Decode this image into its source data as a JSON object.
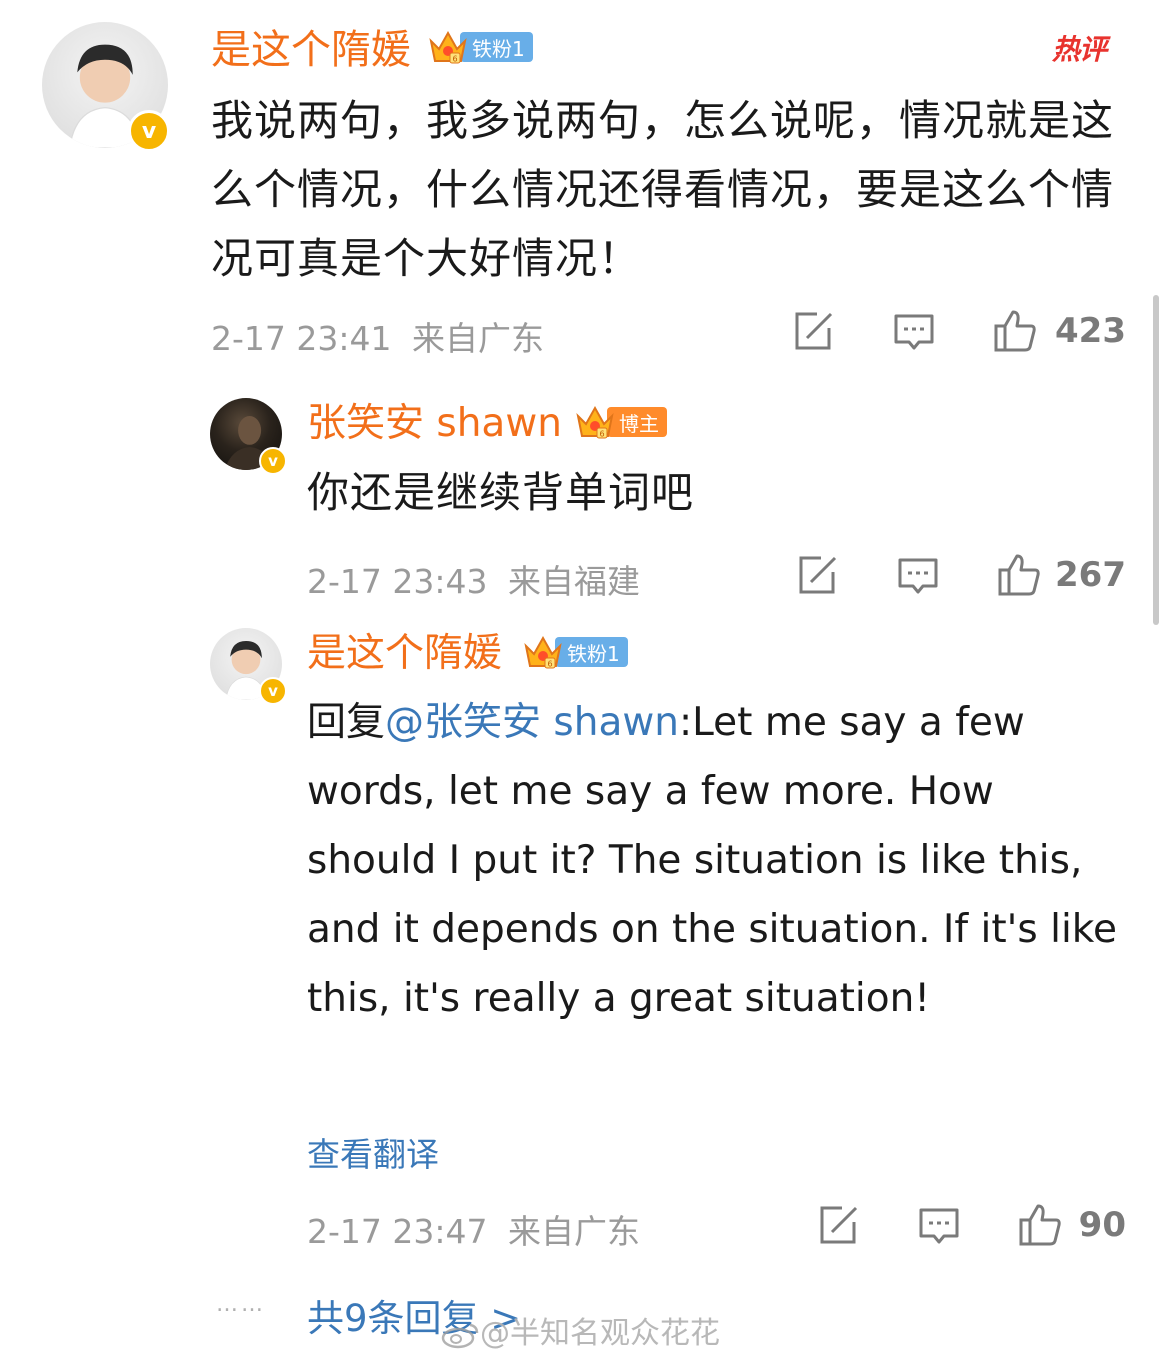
{
  "hot_label": "热评",
  "comment": {
    "username": "是这个隋媛",
    "badge_label": "铁粉1",
    "text": "我说两句，我多说两句，怎么说呢，情况就是这么个情况，什么情况还得看情况，要是这么个情况可真是个大好情况！",
    "timestamp": "2-17 23:41",
    "location": "来自广东",
    "likes": "423"
  },
  "replies": [
    {
      "username": "张笑安 shawn",
      "badge_label": "博主",
      "text": "你还是继续背单词吧",
      "timestamp": "2-17 23:43",
      "location": "来自福建",
      "likes": "267"
    },
    {
      "username": "是这个隋媛",
      "badge_label": "铁粉1",
      "reply_prefix": "回复",
      "mention": "@张笑安 shawn",
      "text": ":Let me say a few words, let me say a few more. How should I put it? The situation is like this, and it depends on the situation. If it's like this, it's really a great situation!",
      "translate_label": "查看翻译",
      "timestamp": "2-17 23:47",
      "location": "来自广东",
      "likes": "90"
    }
  ],
  "more_replies": {
    "dots": "……",
    "label": "共9条回复 >"
  },
  "watermark": "@半知名观众花花",
  "icons": {
    "repost": "repost-icon",
    "comment": "comment-icon",
    "like": "thumbs-up-icon",
    "verified": "verified-badge-icon",
    "crown": "fan-crown-icon"
  },
  "colors": {
    "username": "#f26f1a",
    "link": "#3a78b8",
    "hot": "#e8332e",
    "meta": "#9a9a9a",
    "verified": "#f7b500"
  }
}
